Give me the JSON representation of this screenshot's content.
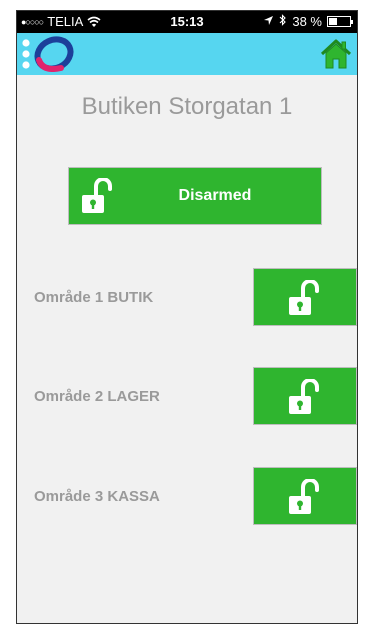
{
  "status_bar": {
    "signal_dots": "●○○○○",
    "carrier": "TELIA",
    "time": "15:13",
    "battery_percent": "38 %",
    "battery_level": 0.38
  },
  "app_bar": {
    "logo_icon": "brand-logo-icon",
    "home_icon": "home-icon",
    "colors": {
      "background": "#56d6f0",
      "home": "#2fb52f"
    }
  },
  "page": {
    "title": "Butiken Storgatan 1"
  },
  "main_status": {
    "label": "Disarmed",
    "icon": "unlocked-padlock-icon",
    "color": "#2fb52f"
  },
  "areas": [
    {
      "label": "Område 1 BUTIK",
      "icon": "unlocked-padlock-icon"
    },
    {
      "label": "Område 2 LAGER",
      "icon": "unlocked-padlock-icon"
    },
    {
      "label": "Område 3 KASSA",
      "icon": "unlocked-padlock-icon"
    }
  ]
}
